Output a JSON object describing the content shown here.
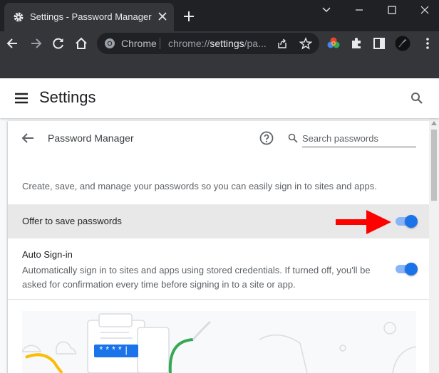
{
  "tab": {
    "title": "Settings - Password Manager",
    "icon": "gear-icon"
  },
  "window_controls": [
    "chevron-down-icon",
    "minimize-icon",
    "maximize-icon",
    "close-icon"
  ],
  "omnibox": {
    "chrome_label": "Chrome",
    "url_scheme": "chrome://",
    "url_host": "settings",
    "url_path": "/pa..."
  },
  "toolbar_icons": [
    "back-icon",
    "forward-icon",
    "reload-icon",
    "home-icon",
    "share-icon",
    "bookmark-star-icon",
    "color-extension-icon",
    "puzzle-icon",
    "sidebar-icon",
    "profile-avatar"
  ],
  "settings": {
    "title": "Settings"
  },
  "page": {
    "subtitle": "Password Manager",
    "search_placeholder": "Search passwords",
    "description": "Create, save, and manage your passwords so you can easily sign in to sites and apps."
  },
  "offer": {
    "label": "Offer to save passwords",
    "enabled": true
  },
  "autosignin": {
    "title": "Auto Sign-in",
    "description": "Automatically sign in to sites and apps using stored credentials. If turned off, you'll be asked for confirmation every time before signing in to a site or app.",
    "enabled": true
  },
  "illustration": {
    "password_text": "****|"
  },
  "colors": {
    "accent": "#1a73e8",
    "arrow": "#ff0000",
    "highlight_row": "#e8e8e8"
  }
}
